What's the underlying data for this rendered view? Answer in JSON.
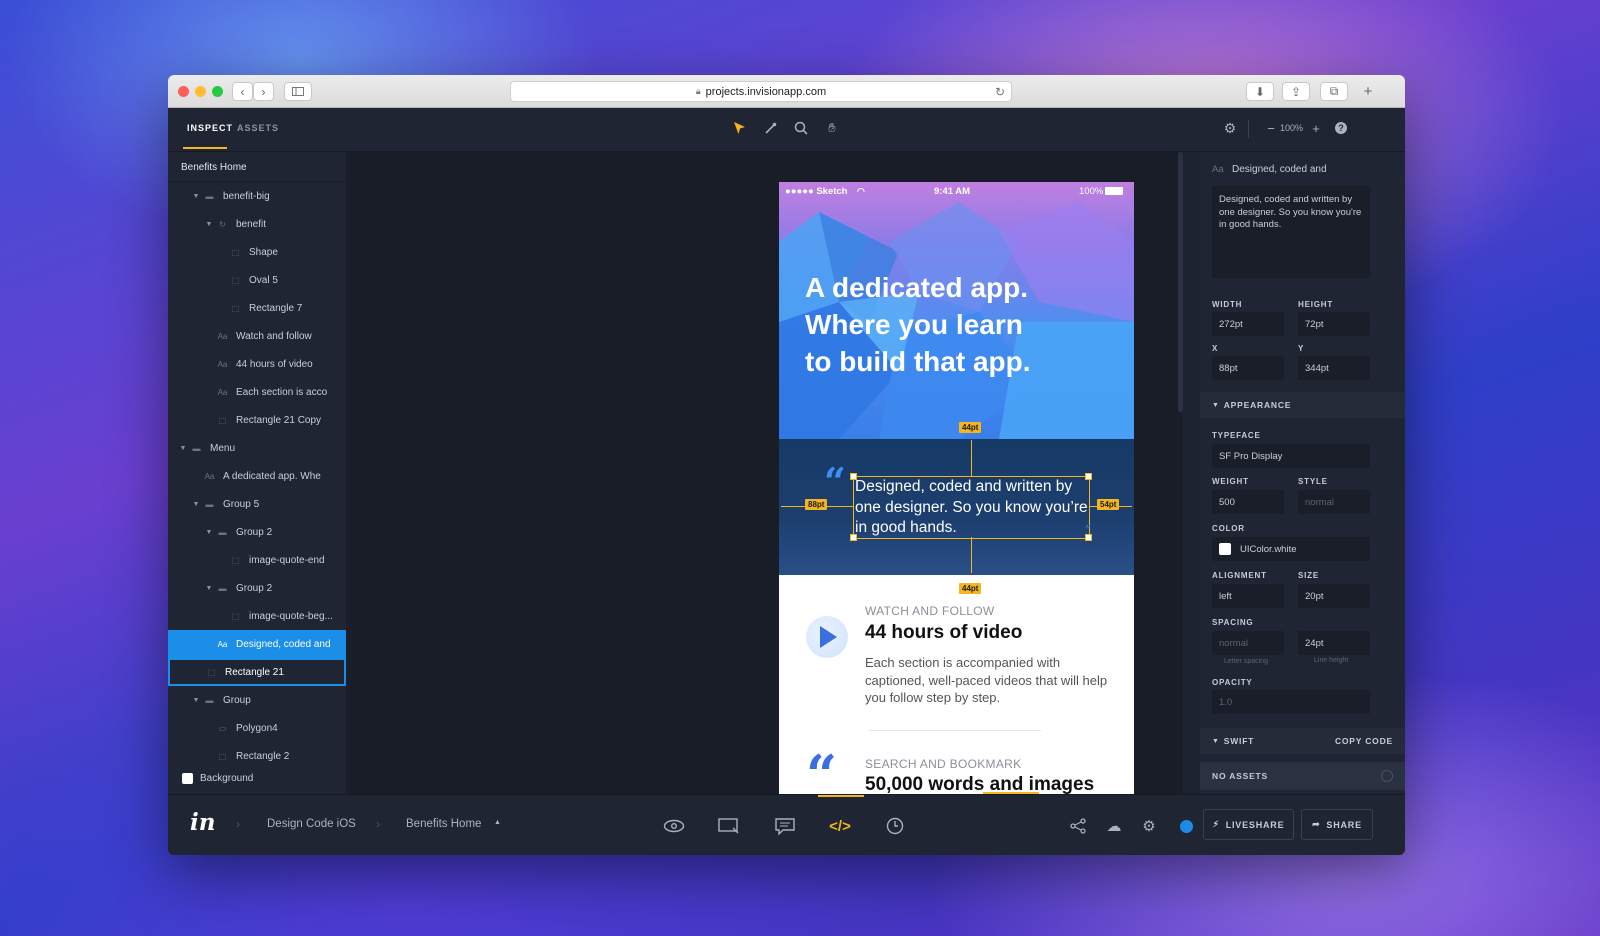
{
  "browser": {
    "url": "projects.invisionapp.com",
    "traffic_lights": [
      "#ff5f57",
      "#febc2e",
      "#28c840"
    ]
  },
  "toolbar": {
    "tabs": [
      "INSPECT",
      "ASSETS"
    ],
    "active_tab": "INSPECT",
    "zoom": "100%",
    "accent": "#f5b51e"
  },
  "layers": {
    "root": "Benefits Home",
    "items": [
      {
        "label": "benefit-big",
        "icon": "folder-icon"
      },
      {
        "label": "benefit",
        "icon": "symbol-icon"
      },
      {
        "label": "Shape",
        "icon": "shape-icon"
      },
      {
        "label": "Oval 5",
        "icon": "shape-icon"
      },
      {
        "label": "Rectangle 7",
        "icon": "shape-icon"
      },
      {
        "label": "Watch and follow",
        "icon": "text-icon"
      },
      {
        "label": "44 hours of video",
        "icon": "text-icon"
      },
      {
        "label": "Each section is acco",
        "icon": "text-icon"
      },
      {
        "label": "Rectangle 21 Copy",
        "icon": "shape-icon"
      },
      {
        "label": "Menu",
        "icon": "folder-icon"
      },
      {
        "label": "A dedicated app. Whe",
        "icon": "text-icon"
      },
      {
        "label": "Group 5",
        "icon": "folder-icon"
      },
      {
        "label": "Group 2",
        "icon": "folder-icon"
      },
      {
        "label": "image-quote-end",
        "icon": "shape-icon"
      },
      {
        "label": "Group 2",
        "icon": "folder-icon"
      },
      {
        "label": "image-quote-beg...",
        "icon": "shape-icon"
      },
      {
        "label": "Designed, coded and",
        "icon": "text-icon"
      },
      {
        "label": "Rectangle 21",
        "icon": "shape-icon"
      },
      {
        "label": "Group",
        "icon": "folder-icon"
      },
      {
        "label": "Polygon4",
        "icon": "image-icon"
      },
      {
        "label": "Rectangle 2",
        "icon": "shape-icon"
      }
    ],
    "background_label": "Background",
    "selected_text": "Aa",
    "selected_color": "#1b8fe8"
  },
  "phone": {
    "status": {
      "carrier": "●●●●● Sketch",
      "time": "9:41 AM",
      "battery": "100%"
    },
    "hero_title": "A dedicated app. Where you learn to build that app.",
    "quote_text": "Designed, coded and written by one designer. So you know you’re in good hands.",
    "measure": {
      "top": "44pt",
      "left": "88pt",
      "right": "54pt",
      "bottom": "44pt"
    },
    "section1": {
      "eyebrow": "WATCH AND FOLLOW",
      "title": "44 hours of video",
      "body": "Each section is accompanied with captioned, well-paced videos that will help you follow step by step."
    },
    "section2": {
      "eyebrow": "SEARCH AND BOOKMARK",
      "title": "50,000 words and images"
    }
  },
  "inspect": {
    "layer_name": "Designed, coded and",
    "text_content": "Designed, coded and written by one designer. So you know you're in good hands.",
    "width_label": "WIDTH",
    "width": "272pt",
    "height_label": "HEIGHT",
    "height": "72pt",
    "x_label": "X",
    "x": "88pt",
    "y_label": "Y",
    "y": "344pt",
    "appearance": "APPEARANCE",
    "typeface_label": "TYPEFACE",
    "typeface": "SF Pro Display",
    "weight_label": "WEIGHT",
    "weight": "500",
    "style_label": "STYLE",
    "style": "normal",
    "color_label": "COLOR",
    "color": "UIColor.white",
    "alignment_label": "ALIGNMENT",
    "alignment": "left",
    "size_label": "SIZE",
    "size": "20pt",
    "spacing_label": "SPACING",
    "letter_spacing": "normal",
    "line_height": "24pt",
    "letter_spacing_caption": "Letter spacing",
    "line_height_caption": "Line height",
    "opacity_label": "OPACITY",
    "opacity": "1.0",
    "swift": "SWIFT",
    "copy_code": "COPY CODE",
    "no_assets": "NO ASSETS"
  },
  "bottom": {
    "logo": "in",
    "breadcrumb": [
      "Design Code iOS",
      "Benefits Home"
    ],
    "liveshare": "LIVESHARE",
    "share": "SHARE"
  }
}
